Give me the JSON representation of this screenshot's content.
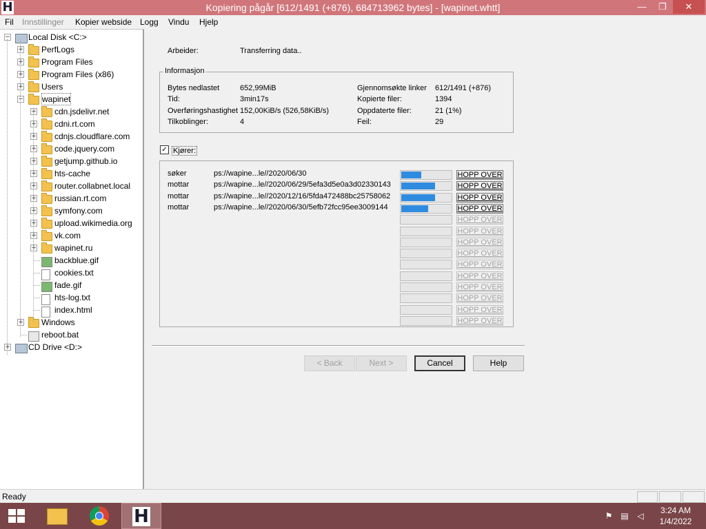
{
  "window": {
    "title": "Kopiering pågår [612/1491 (+876), 684713962 bytes] - [wapinet.whtt]",
    "app_icon_glyph": "H",
    "controls": {
      "minimize": "—",
      "maximize": "❐",
      "close": "✕"
    }
  },
  "menu": [
    "Fil",
    "Innstillinger",
    "Kopier webside",
    "Logg",
    "Vindu",
    "Hjelp"
  ],
  "tree": [
    {
      "label": "Local Disk <C:>",
      "icon": "drive-icon",
      "expander": "−"
    },
    {
      "label": "PerfLogs",
      "icon": "folder-icon",
      "expander": "+"
    },
    {
      "label": "Program Files",
      "icon": "folder-icon",
      "expander": "+"
    },
    {
      "label": "Program Files (x86)",
      "icon": "folder-icon",
      "expander": "+"
    },
    {
      "label": "Users",
      "icon": "folder-icon",
      "expander": "+"
    },
    {
      "label": "wapinet",
      "icon": "folder-icon",
      "expander": "−"
    },
    {
      "label": "cdn.jsdelivr.net",
      "icon": "folder-icon",
      "expander": "+"
    },
    {
      "label": "cdni.rt.com",
      "icon": "folder-icon",
      "expander": "+"
    },
    {
      "label": "cdnjs.cloudflare.com",
      "icon": "folder-icon",
      "expander": "+"
    },
    {
      "label": "code.jquery.com",
      "icon": "folder-icon",
      "expander": "+"
    },
    {
      "label": "getjump.github.io",
      "icon": "folder-icon",
      "expander": "+"
    },
    {
      "label": "hts-cache",
      "icon": "folder-icon",
      "expander": "+"
    },
    {
      "label": "router.collabnet.local",
      "icon": "folder-icon",
      "expander": "+"
    },
    {
      "label": "russian.rt.com",
      "icon": "folder-icon",
      "expander": "+"
    },
    {
      "label": "symfony.com",
      "icon": "folder-icon",
      "expander": "+"
    },
    {
      "label": "upload.wikimedia.org",
      "icon": "folder-icon",
      "expander": "+"
    },
    {
      "label": "vk.com",
      "icon": "folder-icon",
      "expander": "+"
    },
    {
      "label": "wapinet.ru",
      "icon": "folder-icon",
      "expander": "+"
    },
    {
      "label": "backblue.gif",
      "icon": "image-file-icon",
      "expander": ""
    },
    {
      "label": "cookies.txt",
      "icon": "text-file-icon",
      "expander": ""
    },
    {
      "label": "fade.gif",
      "icon": "image-file-icon",
      "expander": ""
    },
    {
      "label": "hts-log.txt",
      "icon": "text-file-icon",
      "expander": ""
    },
    {
      "label": "index.html",
      "icon": "text-file-icon",
      "expander": ""
    },
    {
      "label": "Windows",
      "icon": "folder-icon",
      "expander": "+"
    },
    {
      "label": "reboot.bat",
      "icon": "batch-file-icon",
      "expander": ""
    },
    {
      "label": "CD Drive <D:>",
      "icon": "cd-drive-icon",
      "expander": "+"
    }
  ],
  "main": {
    "status_label": "Arbeider:",
    "status_value": "Transferring data..",
    "info": {
      "title": "Informasjon",
      "left": [
        {
          "label": "Bytes nedlastet",
          "value": "652,99MiB"
        },
        {
          "label": "Tid:",
          "value": "3min17s"
        },
        {
          "label": "Overføringshastighet",
          "value": "152,00KiB/s (526,58KiB/s)"
        },
        {
          "label": "Tilkoblinger:",
          "value": "4"
        }
      ],
      "right": [
        {
          "label": "Gjennomsøkte linker",
          "value": "612/1491 (+876)"
        },
        {
          "label": "Kopierte filer:",
          "value": "1394"
        },
        {
          "label": "Oppdaterte filer:",
          "value": "21 (1%)"
        },
        {
          "label": "Feil:",
          "value": "29"
        }
      ]
    },
    "running_label": "Kjører:",
    "running_checked": "✓",
    "transfers": [
      {
        "action": "søker",
        "url": "ps://wapine...le//2020/06/30",
        "progress": 0.4
      },
      {
        "action": "mottar",
        "url": "ps://wapine...le//2020/06/29/5efa3d5e0a3d02330143",
        "progress": 0.68
      },
      {
        "action": "mottar",
        "url": "ps://wapine...le//2020/12/16/5fda472488bc25758062",
        "progress": 0.68
      },
      {
        "action": "mottar",
        "url": "ps://wapine...le//2020/06/30/5efb72fcc95ee3009144",
        "progress": 0.54
      }
    ],
    "slot_count": 14,
    "skip_label": "HOPP OVER",
    "buttons": {
      "back": "< Back",
      "next": "Next >",
      "cancel": "Cancel",
      "help": "Help"
    }
  },
  "statusbar": {
    "text": "Ready"
  },
  "taskbar": {
    "clock_time": "3:24 AM",
    "clock_date": "1/4/2022",
    "tray": [
      "flag-icon",
      "network-icon",
      "volume-muted-icon"
    ]
  },
  "colors": {
    "titlebar": "#d0767b",
    "taskbar": "#7a4548",
    "progress": "#2f8be0"
  }
}
